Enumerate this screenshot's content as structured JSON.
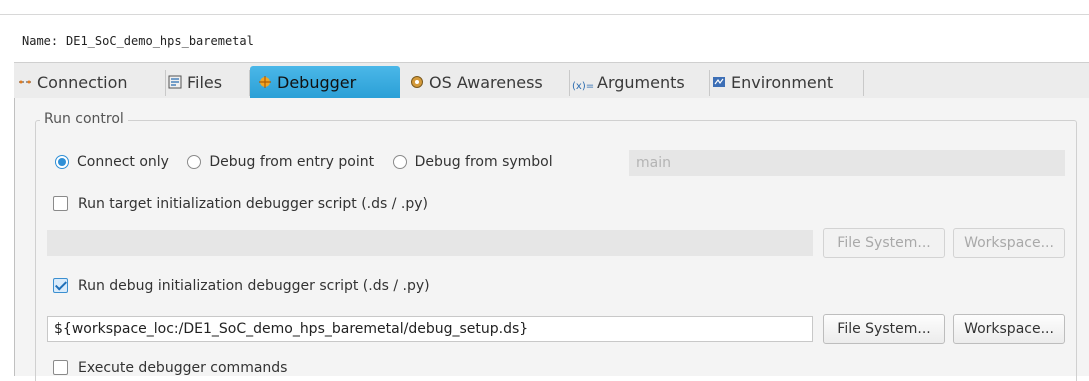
{
  "name_row": {
    "label": "Name:",
    "value": "DE1_SoC_demo_hps_baremetal"
  },
  "tabs": [
    {
      "label": "Connection",
      "icon": "connection-icon",
      "active": false
    },
    {
      "label": "Files",
      "icon": "files-icon",
      "active": false
    },
    {
      "label": "Debugger",
      "icon": "debugger-icon",
      "active": true
    },
    {
      "label": "OS Awareness",
      "icon": "os-awareness-icon",
      "active": false
    },
    {
      "label": "Arguments",
      "icon": "arguments-icon",
      "active": false
    },
    {
      "label": "Environment",
      "icon": "environment-icon",
      "active": false
    }
  ],
  "run_control": {
    "legend": "Run control",
    "radios": [
      {
        "label": "Connect only",
        "selected": true
      },
      {
        "label": "Debug from entry point",
        "selected": false
      },
      {
        "label": "Debug from symbol",
        "selected": false
      }
    ],
    "symbol_placeholder": "main",
    "target_init": {
      "label": "Run target initialization debugger script (.ds / .py)",
      "checked": false,
      "path": ""
    },
    "debug_init": {
      "label": "Run debug initialization debugger script (.ds / .py)",
      "checked": true,
      "path": "${workspace_loc:/DE1_SoC_demo_hps_baremetal/debug_setup.ds}"
    },
    "execute_commands": {
      "label": "Execute debugger commands",
      "checked": false
    },
    "file_system_label": "File System...",
    "workspace_label": "Workspace..."
  },
  "colors": {
    "active_tab": "#2a9fd6",
    "panel_bg": "#f4f4f4",
    "accent": "#2f8fd6"
  }
}
